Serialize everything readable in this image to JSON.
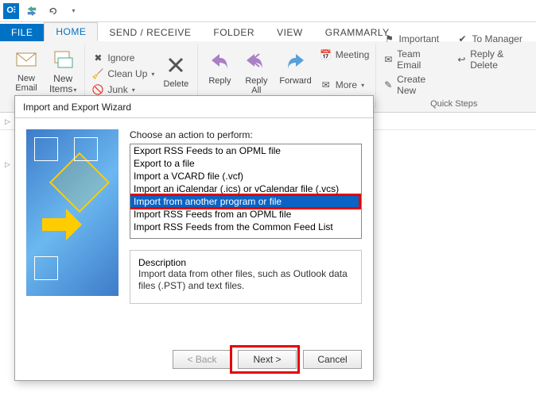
{
  "titlebar": {
    "app": "O⫶"
  },
  "tabs": {
    "file": "FILE",
    "home": "HOME",
    "sendrx": "SEND / RECEIVE",
    "folder": "FOLDER",
    "view": "VIEW",
    "gram": "GRAMMARLY"
  },
  "ribbon": {
    "new_email": "New\nEmail",
    "new_items": "New\nItems",
    "ignore": "Ignore",
    "cleanup": "Clean Up",
    "junk": "Junk",
    "delete": "Delete",
    "reply": "Reply",
    "reply_all": "Reply\nAll",
    "forward": "Forward",
    "meeting": "Meeting",
    "more": "More",
    "qs_important": "Important",
    "qs_team_email": "Team Email",
    "qs_create_new": "Create New",
    "qs_to_manager": "To Manager",
    "qs_reply_delete": "Reply & Delete",
    "quick_steps": "Quick Steps"
  },
  "dialog": {
    "title": "Import and Export Wizard",
    "prompt": "Choose an action to perform:",
    "items": [
      "Export RSS Feeds to an OPML file",
      "Export to a file",
      "Import a VCARD file (.vcf)",
      "Import an iCalendar (.ics) or vCalendar file (.vcs)",
      "Import from another program or file",
      "Import RSS Feeds from an OPML file",
      "Import RSS Feeds from the Common Feed List"
    ],
    "selected_index": 4,
    "description_label": "Description",
    "description_text": "Import data from other files, such as Outlook data files (.PST) and text files.",
    "back": "< Back",
    "next": "Next >",
    "cancel": "Cancel"
  }
}
